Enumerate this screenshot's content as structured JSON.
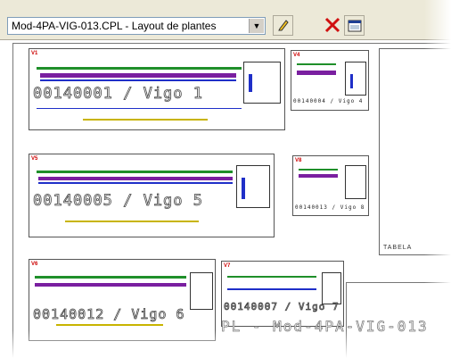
{
  "toolbar": {
    "layout_name": "Mod-4PA-VIG-013.CPL - Layout de plantes",
    "edit_icon": "pencil-icon",
    "delete_icon": "red-x-icon",
    "view_icon": "window-view-icon"
  },
  "drawing": {
    "viewports": [
      {
        "tag": "V1",
        "label": "00140001 / Vigo 1"
      },
      {
        "tag": "V4",
        "label": "00140004 / Vigo 4"
      },
      {
        "tag": "V5",
        "label": "00140005 / Vigo 5"
      },
      {
        "tag": "V8",
        "label": "00140013 / Vigo 8"
      },
      {
        "tag": "V6",
        "label": "00140012 / Vigo 6"
      },
      {
        "tag": "V7",
        "label": "00140007 / Vigo 7"
      }
    ],
    "table_label": "TABELA",
    "footer_title": "PL - Mod-4PA-VIG-013"
  },
  "colors": {
    "beam_green": "#1f8f2a",
    "beam_purple": "#7a1fa0",
    "dim_blue": "#1f2fc8",
    "yellow": "#c8b400",
    "red": "#c81f1f"
  }
}
